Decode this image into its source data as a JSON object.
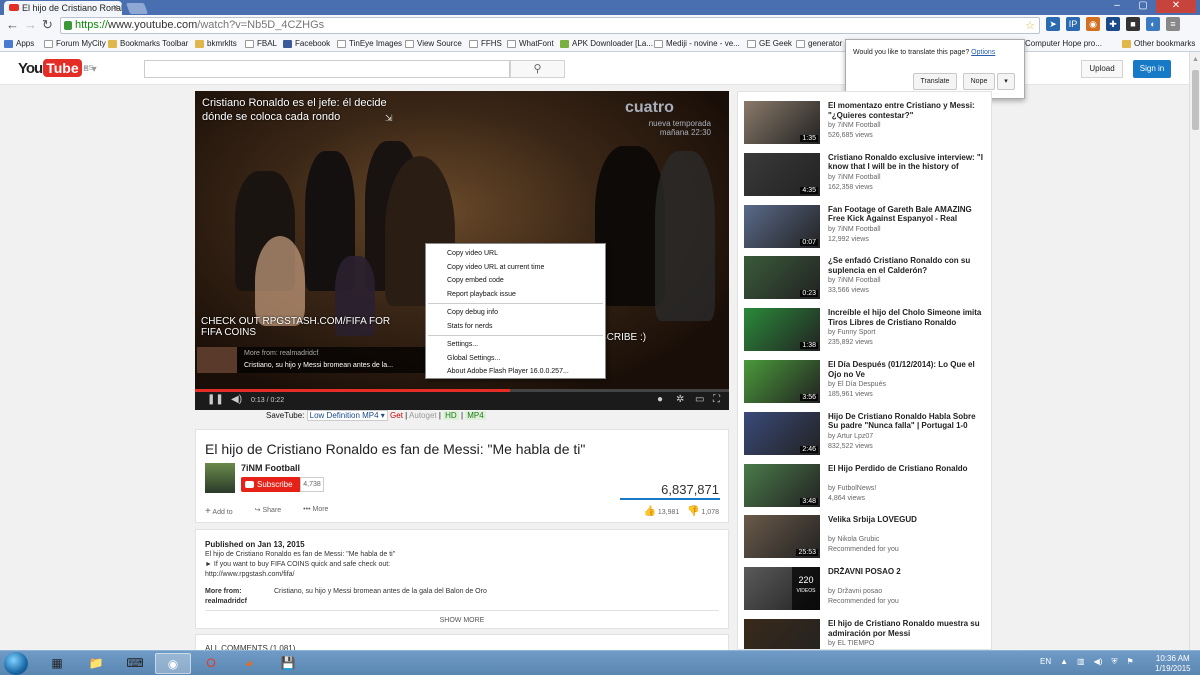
{
  "browser": {
    "tab_title": "El hijo de Cristiano Ronald",
    "tab_close": "×",
    "url_scheme": "https://",
    "url_host": "www.youtube.com",
    "url_path": "/watch?v=Nb5D_4CZHGs",
    "window_buttons": [
      "–",
      "▢",
      "✕"
    ],
    "bookmarks": [
      {
        "label": "Apps",
        "icon": "apps-icon"
      },
      {
        "label": "Forum MyCity",
        "icon": "page-icon"
      },
      {
        "label": "Bookmarks Toolbar",
        "icon": "folder-icon"
      },
      {
        "label": "bkmrklts",
        "icon": "folder-icon"
      },
      {
        "label": "FBAL",
        "icon": "page-icon"
      },
      {
        "label": "Facebook",
        "icon": "facebook-icon"
      },
      {
        "label": "TinEye Images",
        "icon": "page-icon"
      },
      {
        "label": "View Source",
        "icon": "page-icon"
      },
      {
        "label": "FFHS",
        "icon": "page-icon"
      },
      {
        "label": "WhatFont",
        "icon": "page-icon"
      },
      {
        "label": "APK Downloader [La...",
        "icon": "apk-icon"
      },
      {
        "label": "Mediji - novine - ve...",
        "icon": "page-icon"
      },
      {
        "label": "GE Geek",
        "icon": "page-icon"
      },
      {
        "label": "generator",
        "icon": "page-icon"
      },
      {
        "label": "Computer Hope pro...",
        "icon": "page-icon"
      },
      {
        "label": "Other bookmarks",
        "icon": "folder-icon"
      }
    ]
  },
  "translate_popup": {
    "question": "Would you like to translate this page?",
    "options_link": "Options",
    "translate_button": "Translate",
    "nope_button": "Nope"
  },
  "youtube_header": {
    "logo_you": "You",
    "logo_tube": "Tube",
    "country": "RS",
    "search_placeholder": "",
    "upload_button": "Upload",
    "signin_button": "Sign in"
  },
  "player": {
    "overlay_title": "Cristiano Ronaldo es el jefe: él decide dónde se coloca cada rondo",
    "watermark": "cuatro",
    "watermark_sub": "nueva temporada mañana 22:30",
    "promo_text": "CHECK OUT RPGSTASH.COM/FIFA FOR FIFA COINS",
    "subscribe_text": "SCRIBE :)",
    "more_from_label": "More from: realmadridcf",
    "more_from_title": "Cristiano, su hijo y Messi bromean antes de la...",
    "time_current": "0:13",
    "time_total": "0:22",
    "progress": 0.59,
    "context_menu": [
      "Copy video URL",
      "Copy video URL at current time",
      "Copy embed code",
      "Report playback issue",
      "Copy debug info",
      "Stats for nerds",
      "Settings...",
      "Global Settings...",
      "About Adobe Flash Player 16.0.0.257..."
    ]
  },
  "savetube": {
    "label": "SaveTube:",
    "quality": "Low Definition MP4",
    "get": "Get",
    "autoget": "Autoget",
    "hd": "HD",
    "mp4": "MP4"
  },
  "video": {
    "title": "El hijo de Cristiano Ronaldo es fan de Messi: \"Me habla de ti\"",
    "channel": "7iNM Football",
    "subscribe_label": "Subscribe",
    "subscriber_count": "4,738",
    "views": "6,837,871",
    "actions": [
      "Add to",
      "Share",
      "More"
    ],
    "likes": "13,981",
    "dislikes": "1,078"
  },
  "description": {
    "published": "Published on Jan 13, 2015",
    "line1": "El hijo de Cristiano Ronaldo es fan de Messi: \"Me habla de ti\"",
    "line2": "► If you want to buy FIFA COINS quick and safe check out:",
    "line3": "http://www.rpgstash.com/fifa/",
    "more_from_label": "More from:",
    "more_from_channel": "realmadridcf",
    "more_from_value": "Cristiano, su hijo y Messi bromean antes de la gala del Balon de Oro",
    "show_more": "SHOW MORE"
  },
  "comments": {
    "label": "ALL COMMENTS (1,081)"
  },
  "related": [
    {
      "title": "El momentazo entre Cristiano y Messi: \"¿Quieres contestar?\"",
      "by": "by 7iNM Football",
      "views": "526,685 views",
      "duration": "1:35",
      "color": "#8a7a6a"
    },
    {
      "title": "Cristiano Ronaldo exclusive interview: \"I know that I will be in the history of",
      "by": "by 7iNM Football",
      "views": "162,358 views",
      "duration": "4:35",
      "color": "#3a3a3a"
    },
    {
      "title": "Fan Footage of Gareth Bale AMAZING Free Kick Against Espanyol - Real",
      "by": "by 7iNM Football",
      "views": "12,992 views",
      "duration": "0:07",
      "color": "#5a6a8a"
    },
    {
      "title": "¿Se enfadó Cristiano Ronaldo con su suplencia en el Calderón?",
      "by": "by 7iNM Football",
      "views": "33,566 views",
      "duration": "0:23",
      "color": "#3a5a3a"
    },
    {
      "title": "Increíble el hijo del Cholo Simeone imita Tiros Libres de Cristiano Ronaldo",
      "by": "by Funny Sport",
      "views": "235,892 views",
      "duration": "1:38",
      "color": "#2a8a3a"
    },
    {
      "title": "El Día Después (01/12/2014): Lo Que el Ojo no Ve",
      "by": "by El Día Después",
      "views": "185,961 views",
      "duration": "3:56",
      "color": "#4a9a3a"
    },
    {
      "title": "Hijo De Cristiano Ronaldo Habla Sobre Su padre \"Nunca falla\" | Portugal 1-0",
      "by": "by Artur Lpz07",
      "views": "832,522 views",
      "duration": "2:46",
      "color": "#3a4a7a"
    },
    {
      "title": "El Hijo Perdido de Cristiano Ronaldo",
      "by": "by FutbolNews!",
      "views": "4,864 views",
      "duration": "3:48",
      "color": "#4a7a4a"
    },
    {
      "title": "Velika Srbija LOVEGUD",
      "by": "by Nikola Grubic",
      "views": "Recommended for you",
      "duration": "25:53",
      "color": "#6a5a4a"
    },
    {
      "title": "DRŽAVNI POSAO 2",
      "by": "by Državni posao",
      "views": "Recommended for you",
      "duration": "",
      "playlist_count": "220",
      "playlist_label": "VIDEOS",
      "color": "#5a5a5a"
    },
    {
      "title": "El hijo de Cristiano Ronaldo muestra su admiración por Messi",
      "by": "by EL TIEMPO",
      "views": "",
      "duration": "",
      "color": "#3a2a1a"
    }
  ],
  "taskbar": {
    "language": "EN",
    "time": "10:36 AM",
    "date": "1/19/2015"
  }
}
